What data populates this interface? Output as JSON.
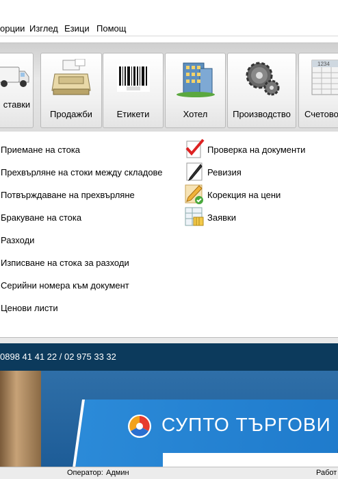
{
  "menu": {
    "items": [
      "орции",
      "Изглед",
      "Езици",
      "Помощ"
    ]
  },
  "ribbon": {
    "tiles": [
      {
        "label": "ставки",
        "icon": "truck-icon"
      },
      {
        "label": "Продажби",
        "icon": "cash-register-icon"
      },
      {
        "label": "Етикети",
        "icon": "barcode-icon"
      },
      {
        "label": "Хотел",
        "icon": "hotel-building-icon"
      },
      {
        "label": "Производство",
        "icon": "gears-icon"
      },
      {
        "label": "Счетовод",
        "icon": "spreadsheet-icon"
      }
    ]
  },
  "left_links": [
    "Приемане на стока",
    "Прехвърляне на стоки между складове",
    "Потвърждаване на прехвърляне",
    "Бракуване на стока",
    "Разходи",
    "Изписване на стока за разходи",
    "Серийни номера към документ",
    "Ценови листи"
  ],
  "right_links": [
    {
      "label": "Проверка на документи",
      "icon": "checkmark-document-icon"
    },
    {
      "label": "Ревизия",
      "icon": "pen-document-icon"
    },
    {
      "label": "Корекция на цени",
      "icon": "pencil-check-icon"
    },
    {
      "label": "Заявки",
      "icon": "order-table-icon"
    }
  ],
  "banner": {
    "phone": "0898 41 41 22 / 02 975 33 32",
    "brand": "СУПТО ТЪРГОВИ"
  },
  "status": {
    "operator_label": "Оператор:",
    "operator_name": "Админ",
    "right_text": "Работ"
  },
  "colors": {
    "banner_dark": "#0c3a5c",
    "banner_blue": "#1f7bcc"
  }
}
